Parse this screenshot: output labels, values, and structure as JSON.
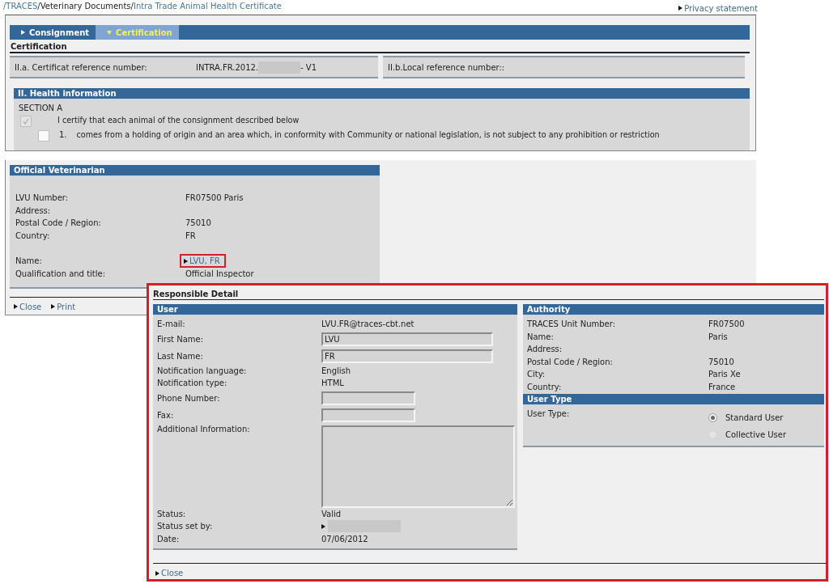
{
  "breadcrumb": [
    {
      "text": "/TRACES",
      "kind": "link"
    },
    {
      "text": "/Veterinary Documents/",
      "kind": "text"
    },
    {
      "text": "Intra Trade Animal Health Certificate",
      "kind": "link"
    }
  ],
  "privacy_link": "Privacy statement",
  "tabs": [
    {
      "label": "Consignment",
      "selected": false
    },
    {
      "label": "Certification",
      "selected": true
    }
  ],
  "section_title": "Certification",
  "reference": [
    {
      "label": "II.a. Certificat reference number:",
      "value_prefix": "INTRA.FR.2012.",
      "redacted": true,
      "value_suffix": "- V1"
    },
    {
      "label": "II.b.Local reference number::",
      "redacted": false
    }
  ],
  "health": {
    "title": "II. Health information",
    "section": "SECTION A",
    "items": [
      {
        "text": "I certify that each animal of the consignment described below",
        "checked": true,
        "disabled": true
      },
      {
        "number": "1.",
        "text": "comes from a holding of origin and an area which, in conformity with Community or national legislation, is not subject to any prohibition or restriction",
        "checked": false,
        "disabled": false
      }
    ]
  },
  "official_veterinarian": {
    "title": "Official Veterinarian",
    "rows": [
      {
        "label": "LVU Number:",
        "value": "FR07500 Paris",
        "kind": "text"
      },
      {
        "label": "Address:",
        "value": "",
        "kind": "text"
      },
      {
        "label": "Postal Code / Region:",
        "value": "75010",
        "kind": "text"
      },
      {
        "label": "Country:",
        "value": "FR",
        "kind": "text"
      },
      {
        "label": "",
        "value": "",
        "kind": "spacer"
      },
      {
        "label": "Name:",
        "value": "LVU, FR",
        "kind": "link",
        "highlighted": true
      },
      {
        "label": "Qualification and title:",
        "value": "Official Inspector",
        "kind": "text"
      }
    ]
  },
  "footer_links": [
    "Close",
    "Print"
  ],
  "popup": {
    "title": "Responsible Detail",
    "user": {
      "title": "User",
      "rows": [
        {
          "label": "E-mail:",
          "value": "LVU.FR@traces-cbt.net",
          "kind": "text"
        },
        {
          "label": "First Name:",
          "value": "LVU",
          "kind": "input"
        },
        {
          "label": "Last Name:",
          "value": "FR",
          "kind": "input"
        },
        {
          "label": "Notification language:",
          "value": "English",
          "kind": "text"
        },
        {
          "label": "Notification type:",
          "value": "HTML",
          "kind": "text"
        },
        {
          "label": "Phone Number:",
          "value": "",
          "kind": "short_input"
        },
        {
          "label": "Fax:",
          "value": "",
          "kind": "short_input"
        },
        {
          "label": "Additional Information:",
          "value": "",
          "kind": "textarea"
        },
        {
          "label": "Status:",
          "value": "Valid",
          "kind": "text"
        },
        {
          "label": "Status set by:",
          "value": "",
          "kind": "redacted_link"
        },
        {
          "label": "Date:",
          "value": "07/06/2012",
          "kind": "text"
        }
      ]
    },
    "authority": {
      "title": "Authority",
      "rows": [
        {
          "label": "TRACES Unit Number:",
          "value": "FR07500"
        },
        {
          "label": "Name:",
          "value": "Paris"
        },
        {
          "label": "Address:",
          "value": ""
        },
        {
          "label": "Postal Code / Region:",
          "value": "75010"
        },
        {
          "label": "City:",
          "value": "Paris Xe"
        },
        {
          "label": "Country:",
          "value": "France"
        }
      ]
    },
    "user_type": {
      "title": "User Type",
      "label": "User Type:",
      "options": [
        {
          "label": "Standard User",
          "selected": true
        },
        {
          "label": "Collective User",
          "selected": false
        }
      ]
    },
    "close": "Close"
  }
}
